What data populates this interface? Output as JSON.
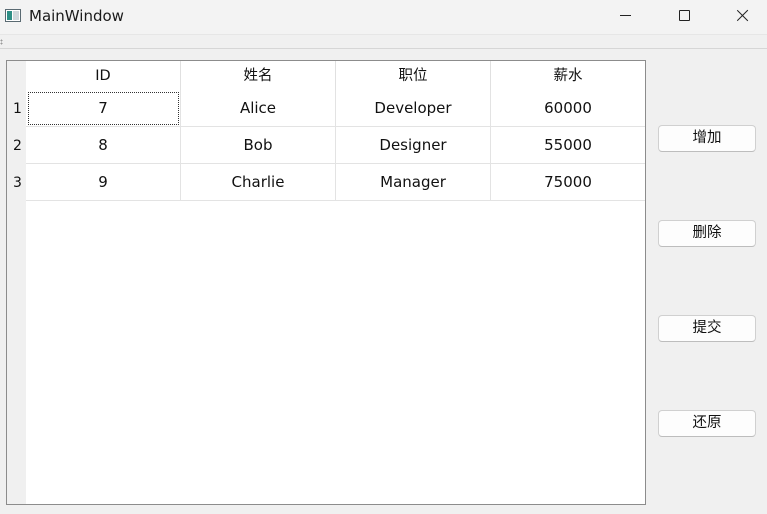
{
  "window": {
    "title": "MainWindow"
  },
  "table": {
    "columns": [
      "ID",
      "姓名",
      "职位",
      "薪水"
    ],
    "rows": [
      {
        "row_number": "1",
        "cells": [
          "7",
          "Alice",
          "Developer",
          "60000"
        ]
      },
      {
        "row_number": "2",
        "cells": [
          "8",
          "Bob",
          "Designer",
          "55000"
        ]
      },
      {
        "row_number": "3",
        "cells": [
          "9",
          "Charlie",
          "Manager",
          "75000"
        ]
      }
    ]
  },
  "buttons": {
    "add_label": "增加",
    "delete_label": "删除",
    "submit_label": "提交",
    "revert_label": "还原"
  },
  "icons": {
    "app": "window-app-icon",
    "minimize": "minimize-icon",
    "maximize": "maximize-icon",
    "close": "close-icon"
  }
}
